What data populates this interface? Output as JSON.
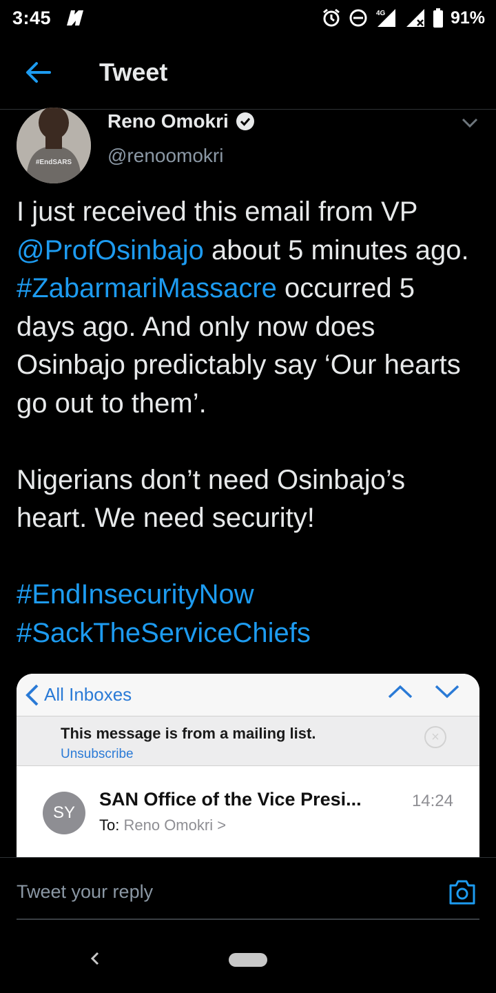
{
  "status_bar": {
    "time": "3:45",
    "network": "4G",
    "battery": "91%"
  },
  "app_bar": {
    "title": "Tweet"
  },
  "tweet": {
    "author_name": "Reno Omokri",
    "author_handle": "@renoomokri",
    "avatar_shirt_text": "#EndSARS",
    "para1": {
      "t1": "I just received this email from VP ",
      "mention": "@ProfOsinbajo",
      "t2": " about 5 minutes ago. ",
      "hashtag": "#ZabarmariMassacre",
      "t3": " occurred 5 days ago. And only now does Osinbajo predictably say ‘Our hearts go out to them’."
    },
    "para2": "Nigerians don’t need Osinbajo’s heart. We need security!",
    "hashtags": [
      "#EndInsecurityNow",
      "#SackTheServiceChiefs"
    ]
  },
  "media": {
    "back_label": "All Inboxes",
    "banner_title": "This message is from a mailing list.",
    "banner_link": "Unsubscribe",
    "sender_initials": "SY",
    "sender": "SAN Office of the Vice Presi...",
    "time": "14:24",
    "to_label": "To:",
    "to_name": "Reno Omokri >"
  },
  "reply": {
    "placeholder": "Tweet your reply"
  },
  "colors": {
    "link": "#1d9bf0",
    "background": "#000000",
    "text": "#e7e9ea",
    "muted": "#8b98a5"
  }
}
